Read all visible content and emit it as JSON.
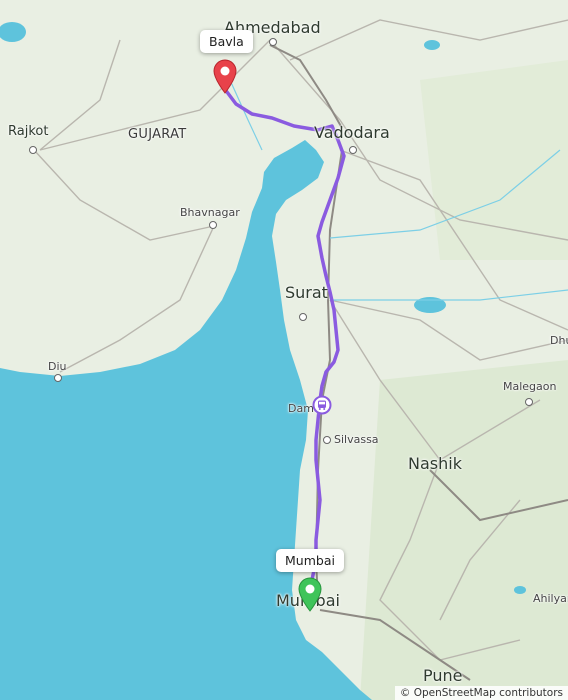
{
  "map": {
    "labels": {
      "ahmedabad": "Ahmedabad",
      "rajkot": "Rajkot",
      "gujarat": "GUJARAT",
      "vadodara": "Vadodara",
      "bhavnagar": "Bhavnagar",
      "surat": "Surat",
      "diu": "Diu",
      "daman": "Daman",
      "silvassa": "Silvassa",
      "nashik": "Nashik",
      "malegaon": "Malegaon",
      "dhule": "Dhu",
      "mumbai": "Mumbai",
      "ahilyanagar": "Ahilyar",
      "pune": "Pune"
    },
    "markers": {
      "origin_label": "Bavla",
      "destination_label": "Mumbai"
    },
    "colors": {
      "route": "#8a5be0",
      "sea": "#5ec3dc",
      "land": "#e9efe3",
      "origin_pin": "#e8424a",
      "destination_pin": "#3fc45a"
    },
    "icons": {
      "origin": "map-pin-icon",
      "destination": "map-pin-icon",
      "waypoint": "bus-icon"
    },
    "attribution": "© OpenStreetMap contributors"
  }
}
